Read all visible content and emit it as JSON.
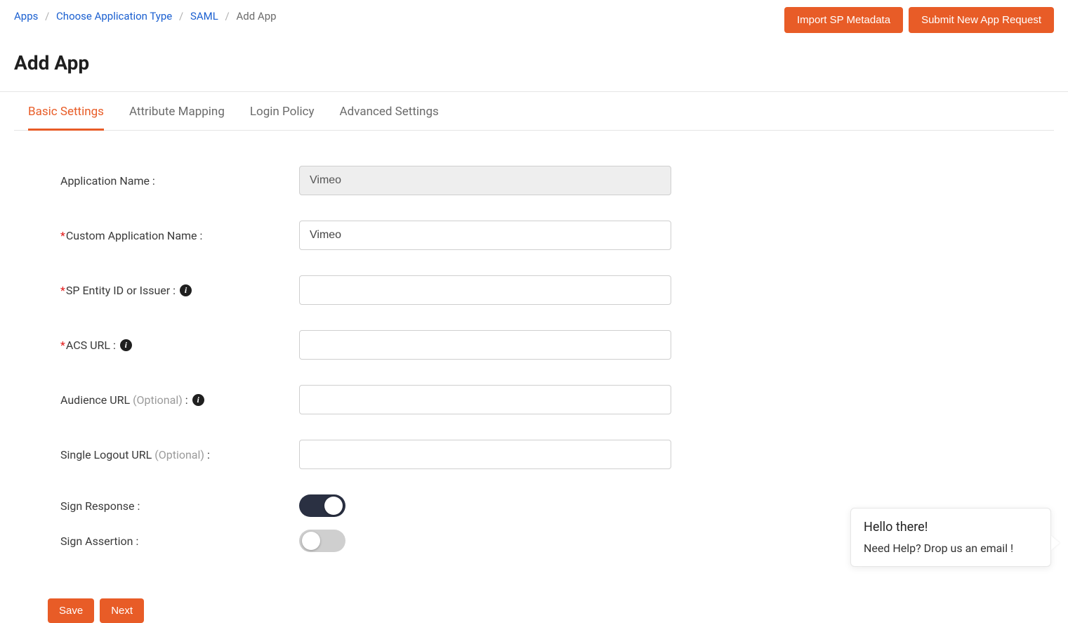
{
  "breadcrumb": {
    "items": [
      "Apps",
      "Choose Application Type",
      "SAML"
    ],
    "current": "Add App"
  },
  "header": {
    "import_button": "Import SP Metadata",
    "request_button": "Submit New App Request",
    "page_title": "Add App"
  },
  "tabs": [
    {
      "label": "Basic Settings",
      "active": true
    },
    {
      "label": "Attribute Mapping",
      "active": false
    },
    {
      "label": "Login Policy",
      "active": false
    },
    {
      "label": "Advanced Settings",
      "active": false
    }
  ],
  "form": {
    "fields": {
      "app_name": {
        "label": "Application Name :",
        "value": "Vimeo",
        "required": false,
        "info": false,
        "disabled": true
      },
      "custom_app_name": {
        "label": "Custom Application Name :",
        "value": "Vimeo",
        "required": true,
        "info": false
      },
      "sp_entity": {
        "label": "SP Entity ID or Issuer :",
        "value": "",
        "required": true,
        "info": true
      },
      "acs_url": {
        "label": "ACS URL :",
        "value": "",
        "required": true,
        "info": true
      },
      "audience_url": {
        "label": "Audience URL",
        "optional": "(Optional)",
        "suffix": " :",
        "value": "",
        "required": false,
        "info": true
      },
      "single_logout": {
        "label": "Single Logout URL",
        "optional": "(Optional)",
        "suffix": " :",
        "value": "",
        "required": false,
        "info": false
      },
      "sign_response": {
        "label": "Sign Response :",
        "on": true
      },
      "sign_assertion": {
        "label": "Sign Assertion :",
        "on": false
      }
    },
    "buttons": {
      "save": "Save",
      "next": "Next"
    }
  },
  "chat": {
    "title": "Hello there!",
    "message": "Need Help? Drop us an email !"
  }
}
